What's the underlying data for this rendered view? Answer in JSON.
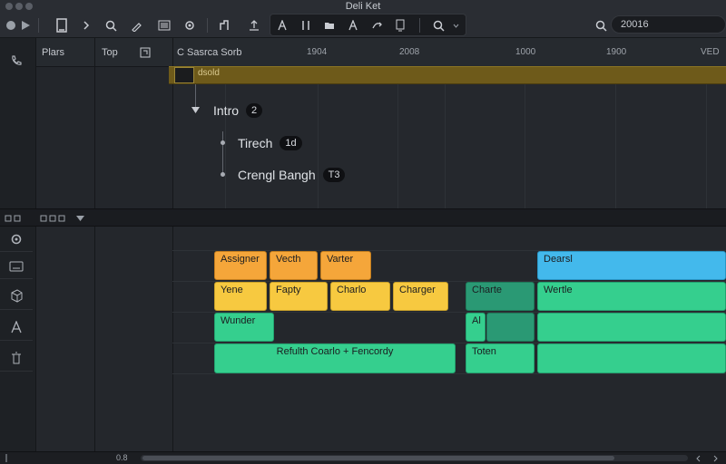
{
  "window": {
    "title": "Deli Ket"
  },
  "search": {
    "value": "20016"
  },
  "headers": {
    "col1": "Plars",
    "col2": "Top",
    "col3": "C Sasrca Sorb"
  },
  "ruler": [
    "1904",
    "2008",
    "1000",
    "1900",
    "VED"
  ],
  "playbar": {
    "label": "dsold"
  },
  "tree": {
    "root": {
      "label": "Intro",
      "badge": "2"
    },
    "children": [
      {
        "label": "Tirech",
        "badge": "1d"
      },
      {
        "label": "Crengl Bangh",
        "badge": "T3"
      }
    ]
  },
  "clips": [
    {
      "id": "c1",
      "label": "Assigner",
      "color": "orange"
    },
    {
      "id": "c2",
      "label": "Vecth",
      "color": "orange"
    },
    {
      "id": "c3",
      "label": "Varter",
      "color": "orange"
    },
    {
      "id": "c4",
      "label": "Dearsl",
      "color": "blue"
    },
    {
      "id": "c5",
      "label": "Yene",
      "color": "yellow"
    },
    {
      "id": "c6",
      "label": "Fapty",
      "color": "yellow"
    },
    {
      "id": "c7",
      "label": "Charlo",
      "color": "yellow"
    },
    {
      "id": "c8",
      "label": "Charger",
      "color": "yellow"
    },
    {
      "id": "c9",
      "label": "Charte",
      "color": "dgreen"
    },
    {
      "id": "c10",
      "label": "Wertle",
      "color": "green"
    },
    {
      "id": "c11",
      "label": "Wunder",
      "color": "green"
    },
    {
      "id": "c12",
      "label": "Al",
      "color": "green"
    },
    {
      "id": "c13",
      "label": "",
      "color": "dgreen"
    },
    {
      "id": "c14",
      "label": "",
      "color": "green"
    },
    {
      "id": "c15",
      "label": "Refulth Coarlo + Fencordy",
      "color": "green"
    },
    {
      "id": "c16",
      "label": "Toten",
      "color": "green"
    },
    {
      "id": "c17",
      "label": "",
      "color": "green"
    }
  ],
  "bottom": {
    "zoom_label": "0.8"
  }
}
